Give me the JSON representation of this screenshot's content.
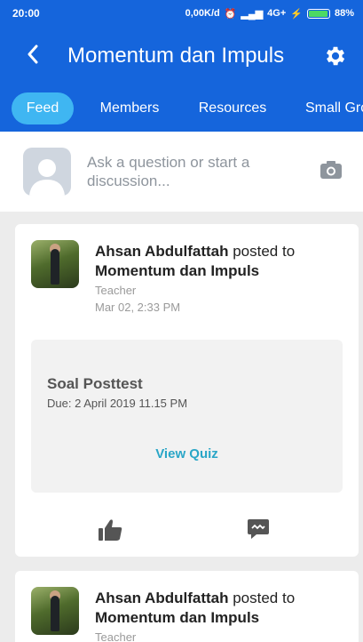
{
  "status_bar": {
    "time": "20:00",
    "network_speed": "0,00K/d",
    "signal": "4G+",
    "battery": "88%"
  },
  "app_bar": {
    "title": "Momentum dan Impuls"
  },
  "tabs": [
    {
      "label": "Feed",
      "active": true
    },
    {
      "label": "Members",
      "active": false
    },
    {
      "label": "Resources",
      "active": false
    },
    {
      "label": "Small Gro",
      "active": false
    }
  ],
  "composer": {
    "prompt_line1": "Ask a question or start a",
    "prompt_line2": "discussion..."
  },
  "posts": [
    {
      "author": "Ahsan Abdulfattah",
      "action": " posted to",
      "group": "Momentum dan Impuls",
      "role": "Teacher",
      "date": "Mar 02, 2:33 PM",
      "quiz": {
        "title": "Soal Posttest",
        "due": "Due: 2 April 2019 11.15 PM",
        "link": "View Quiz"
      }
    },
    {
      "author": "Ahsan Abdulfattah",
      "action": " posted to",
      "group": "Momentum dan Impuls",
      "role": "Teacher"
    }
  ],
  "colors": {
    "primary": "#1565dc",
    "tab_active": "#3fb6f2",
    "link": "#2aa6c7",
    "background": "#ececec"
  }
}
